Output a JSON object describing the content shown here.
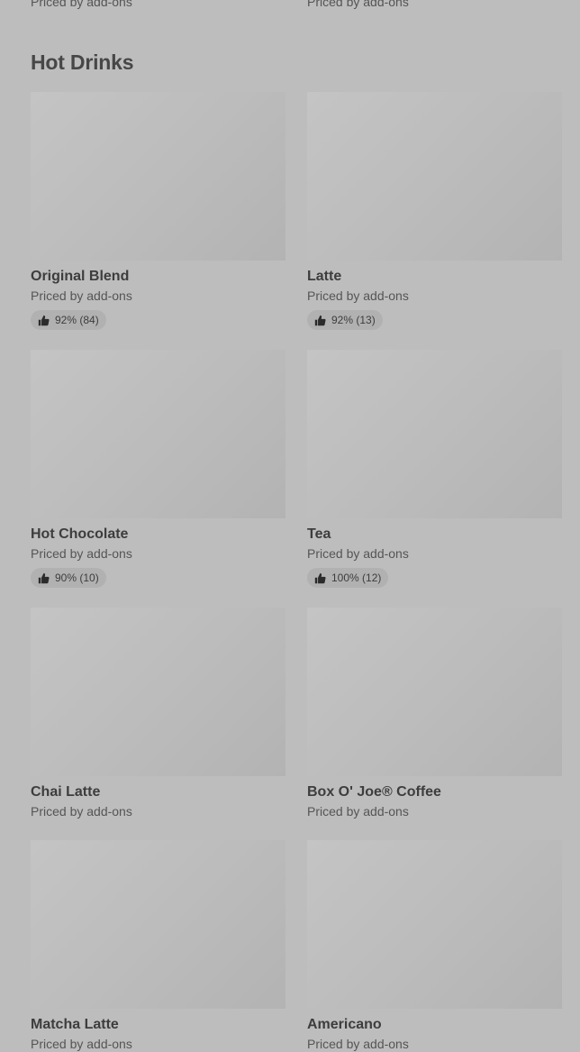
{
  "top_row": {
    "left_price": "Priced by add-ons",
    "right_price": "Priced by add-ons"
  },
  "section": {
    "title": "Hot Drinks"
  },
  "items": [
    {
      "name": "Original Blend",
      "price": "Priced by add-ons",
      "rating": "92% (84)"
    },
    {
      "name": "Latte",
      "price": "Priced by add-ons",
      "rating": "92% (13)"
    },
    {
      "name": "Hot Chocolate",
      "price": "Priced by add-ons",
      "rating": "90% (10)"
    },
    {
      "name": "Tea",
      "price": "Priced by add-ons",
      "rating": "100% (12)"
    },
    {
      "name": "Chai Latte",
      "price": "Priced by add-ons"
    },
    {
      "name": "Box O' Joe® Coffee",
      "price": "Priced by add-ons"
    },
    {
      "name": "Matcha Latte",
      "price": "Priced by add-ons"
    },
    {
      "name": "Americano",
      "price": "Priced by add-ons"
    }
  ],
  "icons": {
    "rating_icon": "thumbs-up-icon"
  }
}
